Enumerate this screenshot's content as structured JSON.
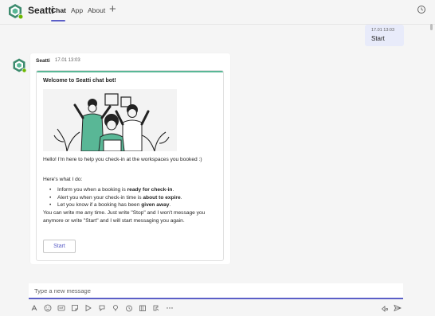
{
  "header": {
    "app_name": "Seatti",
    "tabs": [
      {
        "label": "Chat",
        "active": true
      },
      {
        "label": "App",
        "active": false
      },
      {
        "label": "About",
        "active": false
      }
    ],
    "add_tab": "+"
  },
  "thread": {
    "my_message": {
      "time": "17.01 13:03",
      "text": "Start"
    },
    "bot_message": {
      "sender": "Seatti",
      "time": "17.01 13:03",
      "card": {
        "title": "Welcome to Seatti chat bot!",
        "intro": "Hello! I'm here to help you check-in at the workspaces you booked :)",
        "list_heading": "Here's what I do:",
        "bullets": [
          {
            "pre": "Inform you when a booking is ",
            "bold": "ready for check-in",
            "post": "."
          },
          {
            "pre": "Alert you when your check-in time is ",
            "bold": "about to expire",
            "post": "."
          },
          {
            "pre": "Let you know if a booking has been ",
            "bold": "given away",
            "post": "."
          }
        ],
        "outro": "You can write me any time. Just write \"Stop\" and I won't message you anymore or write \"Start\" and I will start messaging you again.",
        "button_label": "Start"
      }
    }
  },
  "compose": {
    "placeholder": "Type a new message",
    "toolbar_icons": [
      "format-icon",
      "emoji-icon",
      "gif-icon",
      "sticker-icon",
      "schedule-meeting-icon",
      "praise-icon",
      "loop-icon",
      "stream-icon",
      "viva-icon",
      "more-icon"
    ],
    "send_icons": [
      "dictate-icon",
      "send-icon"
    ]
  },
  "colors": {
    "accent": "#5b5fc7",
    "brand_green": "#59b796",
    "own_bubble": "#e8ebfa"
  }
}
